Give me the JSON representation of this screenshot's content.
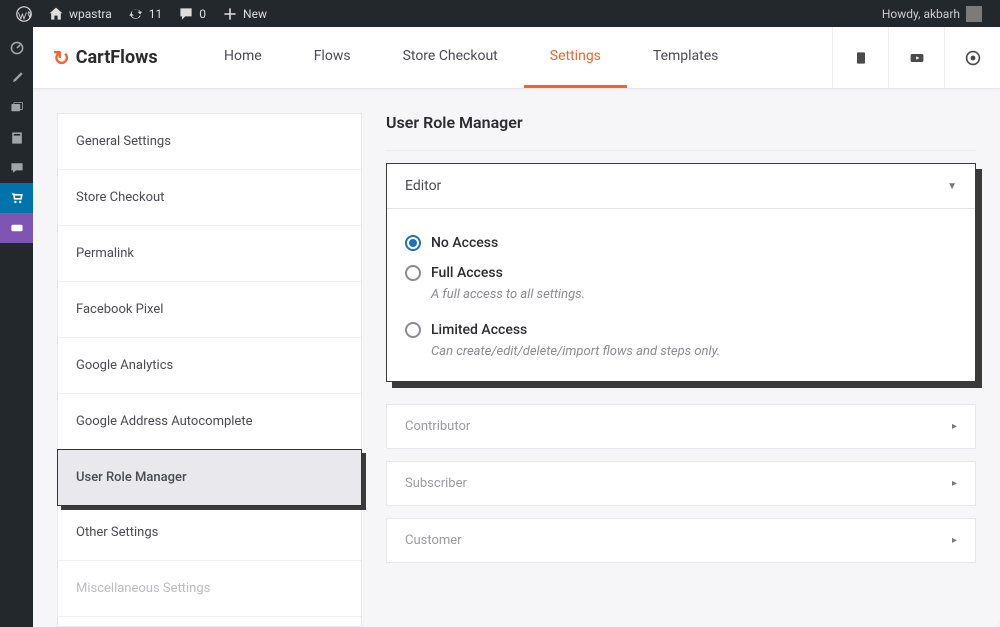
{
  "admin_bar": {
    "site_name": "wpastra",
    "update_count": "11",
    "comment_count": "0",
    "new_label": "New",
    "howdy": "Howdy, akbarh"
  },
  "brand": "CartFlows",
  "nav": {
    "home": "Home",
    "flows": "Flows",
    "store_checkout": "Store Checkout",
    "settings": "Settings",
    "templates": "Templates"
  },
  "settings_sidebar": {
    "general": "General Settings",
    "store_checkout": "Store Checkout",
    "permalink": "Permalink",
    "facebook_pixel": "Facebook Pixel",
    "google_analytics": "Google Analytics",
    "google_address": "Google Address Autocomplete",
    "user_role_manager": "User Role Manager",
    "other": "Other Settings",
    "misc": "Miscellaneous Settings"
  },
  "page_title": "User Role Manager",
  "expanded_role": {
    "name": "Editor",
    "options": {
      "no_access": "No Access",
      "full_access": "Full Access",
      "full_access_desc": "A full access to all settings.",
      "limited": "Limited Access",
      "limited_desc": "Can create/edit/delete/import flows and steps only."
    }
  },
  "collapsed_roles": {
    "contributor": "Contributor",
    "subscriber": "Subscriber",
    "customer": "Customer"
  }
}
